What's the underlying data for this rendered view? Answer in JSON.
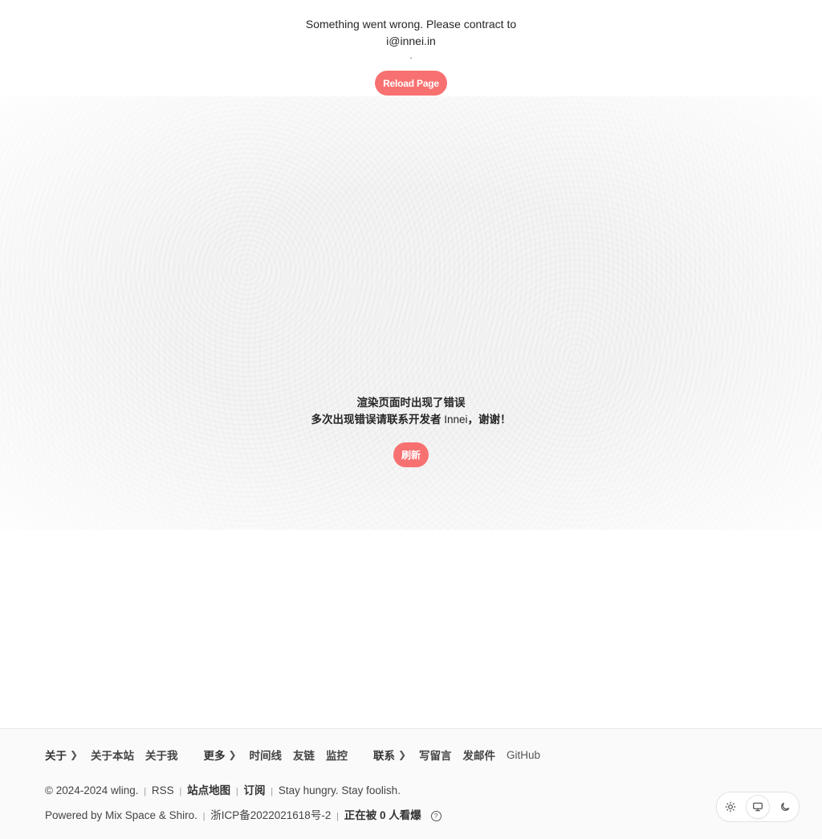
{
  "top_error": {
    "message": "Something went wrong. Please contract to i@innei.in",
    "dot": ".",
    "button_label": "Reload Page"
  },
  "mid_error": {
    "line1": "渲染页面时出现了错误",
    "line2_pre": "多次出现错误请联系开发者 ",
    "line2_name": "Innei",
    "line2_post": "，谢谢！",
    "button_label": "刷新"
  },
  "footer": {
    "nav": [
      {
        "head": "关于",
        "links": [
          "关于本站",
          "关于我"
        ]
      },
      {
        "head": "更多",
        "links": [
          "时间线",
          "友链",
          "监控"
        ]
      },
      {
        "head": "联系",
        "links": [
          "写留言",
          "发邮件",
          "GitHub"
        ]
      }
    ],
    "copyright": "© 2024-2024 wling.",
    "rss": "RSS",
    "sitemap": "站点地图",
    "subscribe": "订阅",
    "motto": "Stay hungry. Stay foolish.",
    "powered_by": "Powered by Mix Space & Shiro.",
    "icp": "浙ICP备2022021618号-2",
    "viewers": "正在被 0 人看爆",
    "separator": "|"
  },
  "theme_switcher": {
    "options": [
      "light-icon",
      "system-icon",
      "dark-icon"
    ],
    "active": "system-icon"
  },
  "colors": {
    "accent": "#f87171"
  }
}
